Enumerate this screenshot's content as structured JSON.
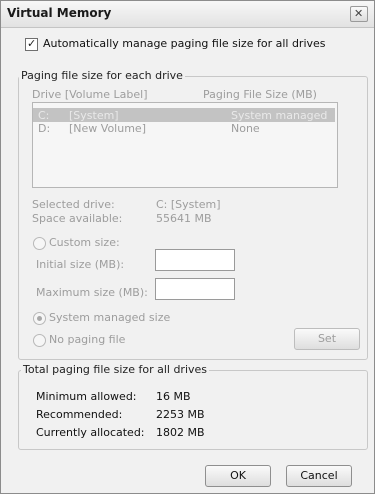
{
  "window": {
    "title": "Virtual Memory",
    "close_glyph": "✕"
  },
  "auto_manage": {
    "label": "Automatically manage paging file size for all drives",
    "checked": true,
    "check_glyph": "✓"
  },
  "paging_group": {
    "legend": "Paging file size for each drive",
    "col_drive": "Drive  [Volume Label]",
    "col_size": "Paging File Size (MB)",
    "drives": [
      {
        "drive": "C:",
        "label": "[System]",
        "size": "System managed",
        "selected": true
      },
      {
        "drive": "D:",
        "label": "[New Volume]",
        "size": "None",
        "selected": false
      }
    ],
    "selected_drive_label": "Selected drive:",
    "selected_drive_value": "C:  [System]",
    "space_label": "Space available:",
    "space_value": "55641 MB",
    "custom_size": "Custom size:",
    "initial_size": "Initial size (MB):",
    "initial_value": "",
    "maximum_size": "Maximum size (MB):",
    "maximum_value": "",
    "system_managed": "System managed size",
    "no_paging": "No paging file",
    "selected_option": "system_managed",
    "set_label": "Set"
  },
  "total_group": {
    "legend": "Total paging file size for all drives",
    "min_label": "Minimum allowed:",
    "min_value": "16 MB",
    "rec_label": "Recommended:",
    "rec_value": "2253 MB",
    "cur_label": "Currently allocated:",
    "cur_value": "1802 MB"
  },
  "buttons": {
    "ok": "OK",
    "cancel": "Cancel"
  }
}
